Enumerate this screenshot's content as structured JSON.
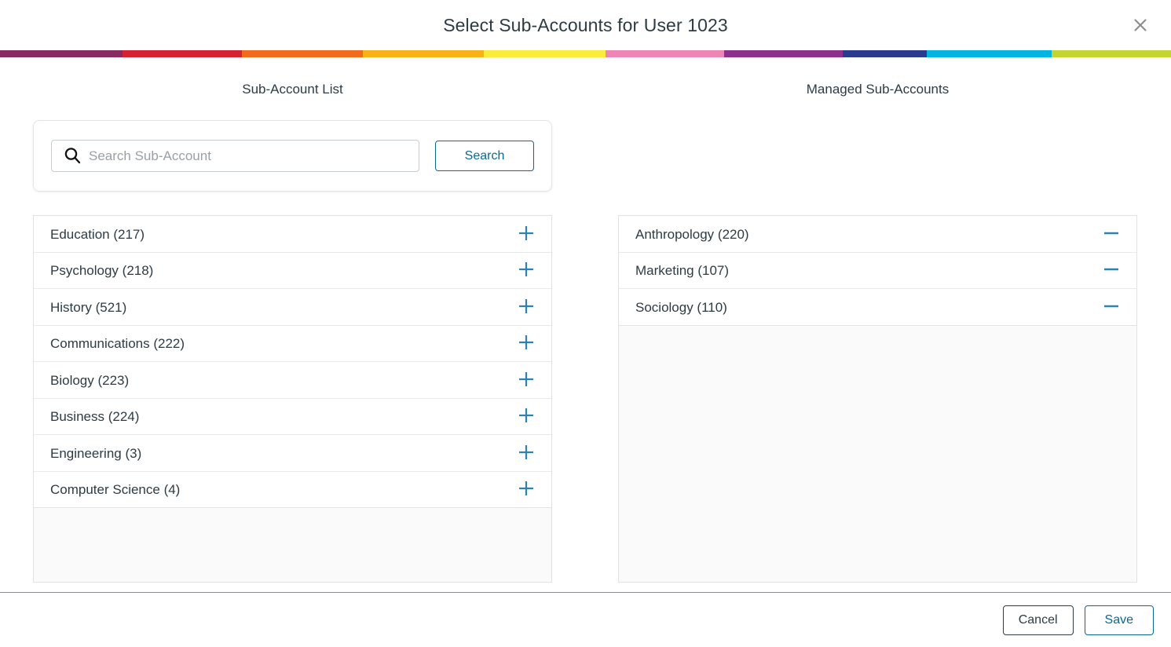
{
  "header": {
    "title": "Select Sub-Accounts for User 1023",
    "close_icon": "close-icon"
  },
  "stripe": {
    "colors": [
      "#8a2a63",
      "#d32232",
      "#f26a1b",
      "#f9b216",
      "#f9ec3b",
      "#ee85b5",
      "#8e2f8e",
      "#2a3b8f",
      "#00b5e2",
      "#c4d430"
    ],
    "widths": [
      150,
      145,
      148,
      148,
      148,
      145,
      145,
      103,
      152,
      146
    ]
  },
  "left_panel": {
    "heading": "Sub-Account List",
    "search": {
      "placeholder": "Search Sub-Account",
      "value": "",
      "button_label": "Search",
      "icon": "search-icon"
    },
    "items": [
      {
        "label": "Education (217)",
        "action_icon": "plus-icon"
      },
      {
        "label": "Psychology (218)",
        "action_icon": "plus-icon"
      },
      {
        "label": "History (521)",
        "action_icon": "plus-icon"
      },
      {
        "label": "Communications (222)",
        "action_icon": "plus-icon"
      },
      {
        "label": "Biology (223)",
        "action_icon": "plus-icon"
      },
      {
        "label": "Business (224)",
        "action_icon": "plus-icon"
      },
      {
        "label": "Engineering (3)",
        "action_icon": "plus-icon"
      },
      {
        "label": "Computer Science (4)",
        "action_icon": "plus-icon"
      }
    ]
  },
  "right_panel": {
    "heading": "Managed Sub-Accounts",
    "items": [
      {
        "label": "Anthropology (220)",
        "action_icon": "minus-icon"
      },
      {
        "label": "Marketing (107)",
        "action_icon": "minus-icon"
      },
      {
        "label": "Sociology (110)",
        "action_icon": "minus-icon"
      }
    ]
  },
  "footer": {
    "cancel_label": "Cancel",
    "save_label": "Save"
  },
  "colors": {
    "accent_blue": "#0b6894",
    "icon_blue": "#2c81b5",
    "text": "#2d3b45"
  }
}
